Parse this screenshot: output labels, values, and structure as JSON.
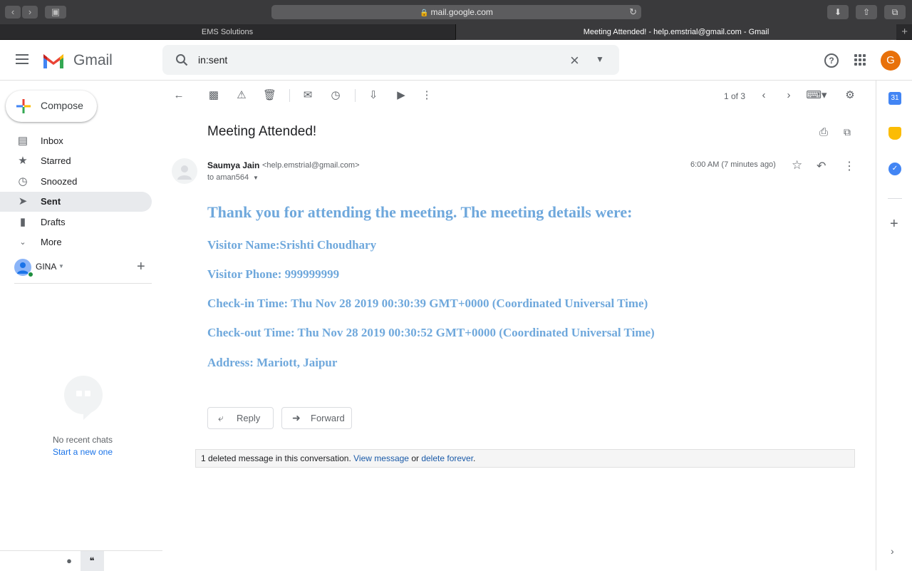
{
  "browser": {
    "url": "mail.google.com",
    "tabs": [
      {
        "label": "EMS Solutions",
        "active": false
      },
      {
        "label": "Meeting Attended! - help.emstrial@gmail.com - Gmail",
        "active": true
      }
    ]
  },
  "header": {
    "app_name": "Gmail",
    "search_query": "in:sent",
    "avatar_letter": "G",
    "avatar_color": "#e8710a"
  },
  "sidebar": {
    "compose_label": "Compose",
    "items": [
      {
        "label": "Inbox",
        "icon": "inbox-icon"
      },
      {
        "label": "Starred",
        "icon": "star-icon"
      },
      {
        "label": "Snoozed",
        "icon": "clock-icon"
      },
      {
        "label": "Sent",
        "icon": "send-icon",
        "active": true
      },
      {
        "label": "Drafts",
        "icon": "draft-icon"
      },
      {
        "label": "More",
        "icon": "chevron-down-icon"
      }
    ],
    "account_name": "GINA",
    "chat_empty": "No recent chats",
    "chat_start": "Start a new one"
  },
  "toolbar": {
    "pager": "1 of 3"
  },
  "message": {
    "subject": "Meeting Attended!",
    "sender_name": "Saumya Jain",
    "sender_email": "<help.emstrial@gmail.com>",
    "to": "to aman564",
    "time": "6:00 AM (7 minutes ago)",
    "body": {
      "heading": "Thank you for attending the meeting. The meeting details were:",
      "visitor_name": "Visitor Name:Srishti Choudhary",
      "visitor_phone": "Visitor Phone: 999999999",
      "check_in": "Check-in Time: Thu Nov 28 2019 00:30:39 GMT+0000 (Coordinated Universal Time)",
      "check_out": "Check-out Time: Thu Nov 28 2019 00:30:52 GMT+0000 (Coordinated Universal Time)",
      "address": "Address: Mariott, Jaipur"
    },
    "body_color": "#6fa8dc",
    "reply_label": "Reply",
    "forward_label": "Forward"
  },
  "deleted_notice": {
    "prefix": "1 deleted message in this conversation.",
    "view_link": "View message",
    "or": "or",
    "delete_link": "delete forever",
    "suffix": "."
  },
  "side_panel": {
    "calendar_day": "31"
  }
}
